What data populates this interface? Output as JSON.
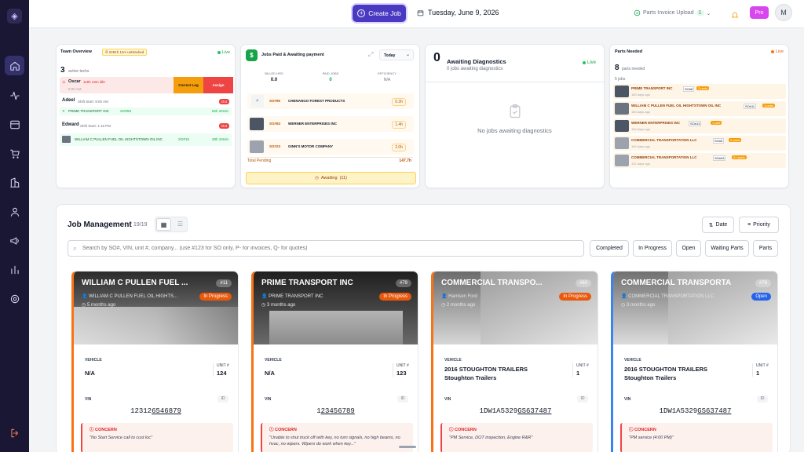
{
  "sidebar": {
    "logo_icon": "shield-logo-icon",
    "items": [
      "home-icon",
      "activity-icon",
      "inbox-icon",
      "cart-icon",
      "buildings-icon",
      "user-icon",
      "megaphone-icon",
      "bar-chart-icon",
      "gear-icon"
    ],
    "exit_icon": "exit-icon"
  },
  "header": {
    "create_label": "Create Job",
    "date": "Tuesday, June 9, 2026",
    "parts_upload_label": "Parts Invoice Upload",
    "parts_upload_count": "1",
    "pro_label": "Pro",
    "avatar_initial": "M"
  },
  "team": {
    "title": "Team Overview",
    "warning": "2281h 11m unttracked",
    "live_label": "Live",
    "active_count": "3",
    "active_label": "active techs",
    "oscar": {
      "name": "Oscar",
      "detail": "115h 43m idle",
      "time": "9:00 AM",
      "correct_label": "Correct Log",
      "assign_label": "Assign"
    },
    "adeel": {
      "name": "Adeel",
      "shift": "Shift Start: 9:00 AM",
      "badge": "Out",
      "job": "PRIME TRANSPORT INC",
      "so": "SO#83",
      "hours": "52h 32min"
    },
    "edward": {
      "name": "Edward",
      "shift": "Shift Start: 1:16 PM",
      "badge": "Out",
      "job": "WILLIAM C PULLEN FUEL OIL HIGHTSTOWN OIL INC",
      "so": "SO#15",
      "hours": "28h 10min"
    }
  },
  "payments": {
    "title": "Jobs Paid & Awaiting payment",
    "period": "Today",
    "billed_label": "BILLED HRS",
    "billed_value": "0.0",
    "paid_label": "PAID JOBS",
    "paid_value": "0",
    "eff_label": "EFFICIENCY",
    "eff_value": "N/A",
    "rows": [
      {
        "so": "SO#96",
        "name": "CHENANGO FOREST PRODUCTS",
        "time": "0.3h"
      },
      {
        "so": "SO#83",
        "name": "WERNER ENTERPRISES INC",
        "time": "1.4h"
      },
      {
        "so": "SO#23",
        "name": "GINN'S MOTOR COMPANY",
        "time": "2.0h"
      }
    ],
    "total_label": "Total Pending",
    "total_value": "147.7h",
    "awaiting_label": "Awaiting",
    "awaiting_count": "(11)"
  },
  "diagnostics": {
    "count": "0",
    "title": "Awaiting Diagnostics",
    "subtitle": "0 jobs awaiting diagnostics",
    "live_label": "Live",
    "empty": "No jobs awaiting diagnostics"
  },
  "parts": {
    "title": "Parts Needed",
    "live_label": "Live",
    "count": "8",
    "count_label": "parts needed",
    "jobs_label": "5 jobs",
    "rows": [
      {
        "name": "PRIME TRANSPORT INC",
        "so": "SO#8",
        "badge": "2 parts",
        "ago": "160 days ago"
      },
      {
        "name": "WILLIAM C PULLEN FUEL OIL HIGHTSTOWN OIL INC",
        "so": "SO#11",
        "badge": "1 parts",
        "ago": "160 days ago"
      },
      {
        "name": "WERNER ENTERPRISES INC",
        "so": "SO#13",
        "badge": "1 part",
        "ago": "164 days ago"
      },
      {
        "name": "COMMERCIAL TRANSPORTATION LLC",
        "so": "SO#5",
        "badge": "2 parts",
        "ago": "160 days ago"
      },
      {
        "name": "COMMERCIAL TRANSPORTATION LLC",
        "so": "SO#43",
        "badge": "2+ parts",
        "ago": "121 days ago"
      }
    ]
  },
  "jobs_section": {
    "title": "Job Management",
    "count": "19/19",
    "sort_date": "Date",
    "sort_priority": "Priority",
    "search_placeholder": "Search by SO#, VIN, unit #, company... (use #123 for SO only, P- for invoices, Q- for quotes)",
    "filters": [
      "Completed",
      "In Progress",
      "Open",
      "Waiting Parts",
      "Parts"
    ],
    "vehicle_label": "VEHICLE",
    "unit_label": "UNIT #",
    "vin_label": "VIN",
    "concern_label": "CONCERN",
    "cards": [
      {
        "title": "WILLIAM C PULLEN FUEL ...",
        "num": "#11",
        "company": "WILLIAM C PULLEN FUEL OIL HIGHTS...",
        "ago": "5 months ago",
        "status": "In Progress",
        "status_color": "#ea580c",
        "accent": "#f97316",
        "vehicle": "N/A",
        "unit": "124",
        "vin_a": "12312",
        "vin_b": "6546879",
        "concern": "\"No Start Service call to cust loc\""
      },
      {
        "title": "PRIME TRANSPORT INC",
        "num": "#79",
        "company": "PRIME TRANSPORT INC",
        "ago": "3 months ago",
        "status": "In Progress",
        "status_color": "#ea580c",
        "accent": "#f97316",
        "vehicle": "N/A",
        "unit": "123",
        "vin_a": "1",
        "vin_b": "23456789",
        "concern": "\"Unable to shut truck off with key, no turn signals, no high beams, no hvac, no wipers. Wipers do work when key...\""
      },
      {
        "title": "COMMERCIAL TRANSPO...",
        "num": "#83",
        "company": "Harrison Ford",
        "ago": "2 months ago",
        "status": "In Progress",
        "status_color": "#ea580c",
        "accent": "#f97316",
        "vehicle": "2016 STOUGHTON TRAILERS Stoughton Trailers",
        "unit": "1",
        "vin_a": "1DW1A5329",
        "vin_b": "GS637487",
        "concern": "\"PM Service, DOT inspection, Engine R&R\""
      },
      {
        "title": "COMMERCIAL TRANSPORTA...",
        "num": "#78",
        "company": "COMMERCIAL TRANSPORTATION LLC",
        "ago": "3 months ago",
        "status": "Open",
        "status_color": "#2563eb",
        "accent": "#3b82f6",
        "vehicle": "2016 STOUGHTON TRAILERS Stoughton Trailers",
        "unit": "1",
        "vin_a": "1DW1A5329",
        "vin_b": "GS637487",
        "concern": "\"PM service (4:00 PM)\""
      }
    ]
  }
}
